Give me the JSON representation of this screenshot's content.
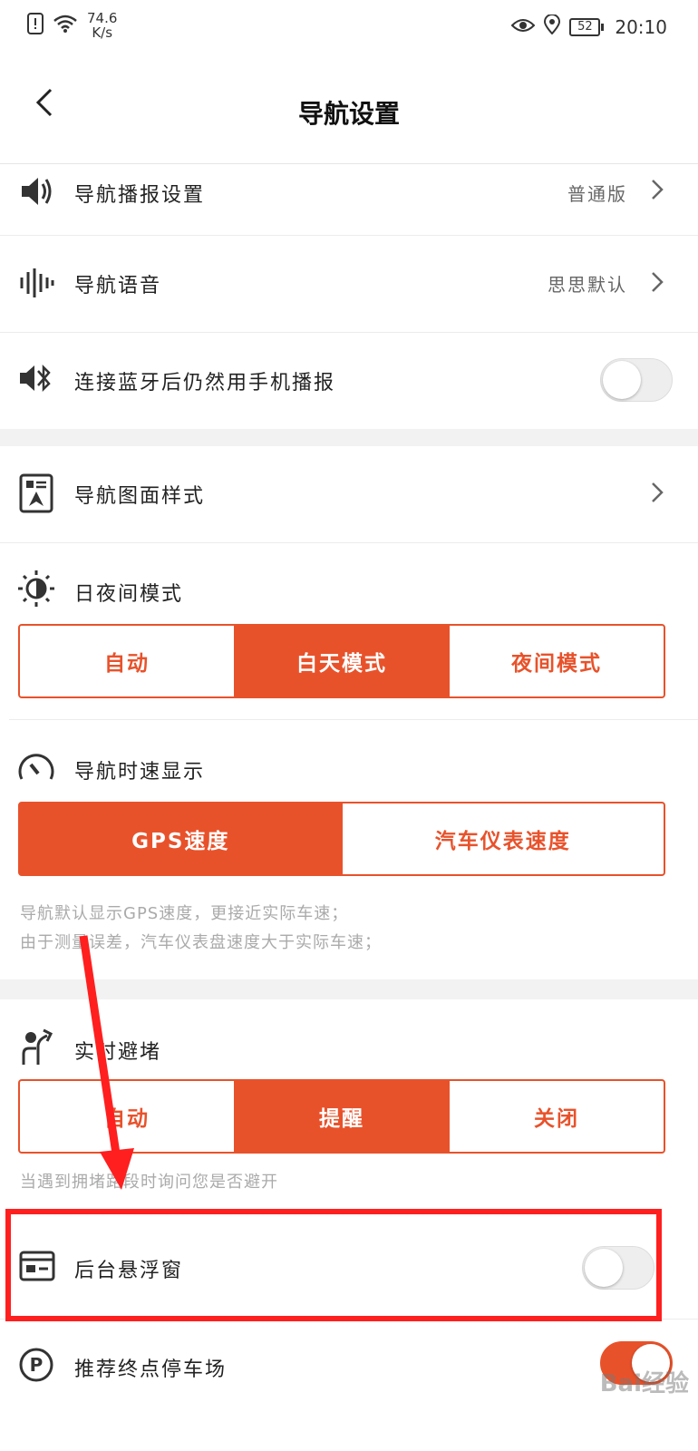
{
  "status": {
    "speed_value": "74.6",
    "speed_unit": "K/s",
    "battery": "52",
    "time": "20:10"
  },
  "header": {
    "title": "导航设置"
  },
  "voice_section": {
    "items": [
      {
        "label": "导航播报设置",
        "value": "普通版"
      },
      {
        "label": "导航语音",
        "value": "思思默认"
      },
      {
        "label": "连接蓝牙后仍然用手机播报",
        "toggle": false
      }
    ]
  },
  "map_section": {
    "style_label": "导航图面样式",
    "day_night": {
      "label": "日夜间模式",
      "options": [
        "自动",
        "白天模式",
        "夜间模式"
      ],
      "selected": 1
    },
    "speed": {
      "label": "导航时速显示",
      "options": [
        "GPS速度",
        "汽车仪表速度"
      ],
      "selected": 0,
      "hint1": "导航默认显示GPS速度，更接近实际车速；",
      "hint2": "由于测量误差，汽车仪表盘速度大于实际车速；"
    }
  },
  "traffic_section": {
    "label": "实时避堵",
    "options": [
      "自动",
      "提醒",
      "关闭"
    ],
    "selected": 1,
    "hint": "当遇到拥堵路段时询问您是否避开",
    "floating_label": "后台悬浮窗",
    "floating_toggle": false,
    "parking_label": "推荐终点停车场",
    "parking_toggle": true
  },
  "watermark": "Bai经验",
  "colors": {
    "accent": "#e8522b",
    "annotation": "#ff1f1f"
  }
}
